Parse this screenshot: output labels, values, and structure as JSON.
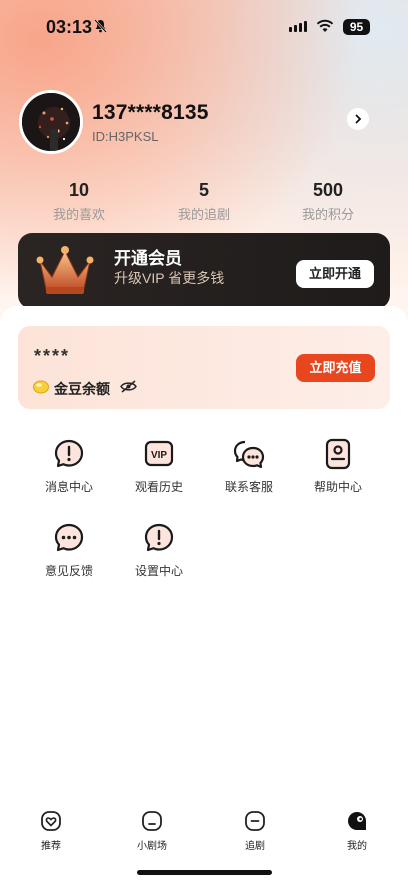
{
  "status_bar": {
    "time": "03:13",
    "battery": "95"
  },
  "profile": {
    "phone": "137****8135",
    "id": "ID:H3PKSL"
  },
  "stats": [
    {
      "value": "10",
      "label": "我的喜欢"
    },
    {
      "value": "5",
      "label": "我的追剧"
    },
    {
      "value": "500",
      "label": "我的积分"
    }
  ],
  "vip": {
    "title": "开通会员",
    "subtitle": "升级VIP 省更多钱",
    "button": "立即开通"
  },
  "coins": {
    "amount": "****",
    "label": "金豆余额",
    "button": "立即充值"
  },
  "menu": [
    {
      "label": "消息中心",
      "icon": "message-center-icon"
    },
    {
      "label": "观看历史",
      "icon": "vip-history-icon"
    },
    {
      "label": "联系客服",
      "icon": "customer-service-icon"
    },
    {
      "label": "帮助中心",
      "icon": "help-center-icon"
    },
    {
      "label": "意见反馈",
      "icon": "feedback-icon"
    },
    {
      "label": "设置中心",
      "icon": "settings-center-icon"
    }
  ],
  "tabs": [
    {
      "label": "推荐",
      "icon": "heart-tab-icon"
    },
    {
      "label": "小剧场",
      "icon": "theater-tab-icon"
    },
    {
      "label": "追剧",
      "icon": "follow-tab-icon"
    },
    {
      "label": "我的",
      "icon": "profile-tab-icon",
      "active": true
    }
  ],
  "colors": {
    "accent": "#e8461e",
    "vip_bg": "#231f1e",
    "coin_card": "#fde6dc"
  }
}
